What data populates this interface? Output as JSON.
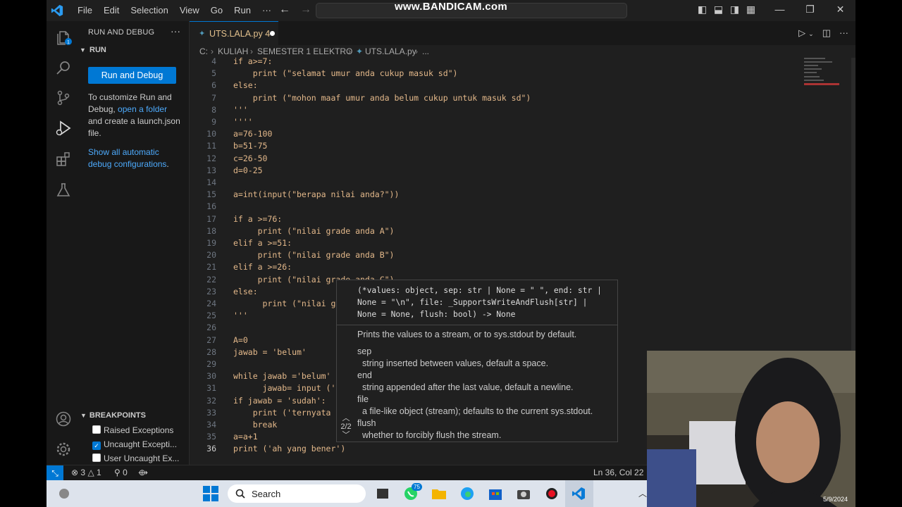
{
  "watermark": "www.BANDICAM.com",
  "menu": [
    "File",
    "Edit",
    "Selection",
    "View",
    "Go",
    "Run",
    "···"
  ],
  "sidebar": {
    "title": "RUN AND DEBUG",
    "section": "RUN",
    "run_button": "Run and Debug",
    "help_line1": "To customize Run and Debug,",
    "help_link": "open a folder",
    "help_line2": "and create a launch.json file.",
    "show_link": "Show all automatic debug configurations",
    "show_end": ".",
    "breakpoints_title": "BREAKPOINTS",
    "breakpoints": [
      {
        "label": "Raised Exceptions",
        "checked": false
      },
      {
        "label": "Uncaught Excepti...",
        "checked": true
      },
      {
        "label": "User Uncaught Ex...",
        "checked": false
      }
    ]
  },
  "tab": {
    "label": "UTS.LALA.py",
    "badge": "4",
    "icon": "python-file-icon"
  },
  "breadcrumb": [
    "C:",
    "KULIAH",
    "SEMESTER 1 ELEKTRO",
    "UTS.LALA.py",
    "..."
  ],
  "code_lines": [
    {
      "n": "4",
      "t": "if a>=7:"
    },
    {
      "n": "5",
      "t": "    print (\"selamat umur anda cukup masuk sd\")"
    },
    {
      "n": "6",
      "t": "else:"
    },
    {
      "n": "7",
      "t": "    print (\"mohon maaf umur anda belum cukup untuk masuk sd\")"
    },
    {
      "n": "8",
      "t": "'''"
    },
    {
      "n": "9",
      "t": "''''"
    },
    {
      "n": "10",
      "t": "a=76-100"
    },
    {
      "n": "11",
      "t": "b=51-75"
    },
    {
      "n": "12",
      "t": "c=26-50"
    },
    {
      "n": "13",
      "t": "d=0-25"
    },
    {
      "n": "14",
      "t": ""
    },
    {
      "n": "15",
      "t": "a=int(input(\"berapa nilai anda?\"))"
    },
    {
      "n": "16",
      "t": ""
    },
    {
      "n": "17",
      "t": "if a >=76:"
    },
    {
      "n": "18",
      "t": "     print (\"nilai grade anda A\")"
    },
    {
      "n": "19",
      "t": "elif a >=51:"
    },
    {
      "n": "20",
      "t": "     print (\"nilai grade anda B\")"
    },
    {
      "n": "21",
      "t": "elif a >=26:"
    },
    {
      "n": "22",
      "t": "     print (\"nilai grade anda C\")"
    },
    {
      "n": "23",
      "t": "else:"
    },
    {
      "n": "24",
      "t": "      print (\"nilai g"
    },
    {
      "n": "25",
      "t": "'''"
    },
    {
      "n": "26",
      "t": ""
    },
    {
      "n": "27",
      "t": "A=0"
    },
    {
      "n": "28",
      "t": "jawab = 'belum'"
    },
    {
      "n": "29",
      "t": ""
    },
    {
      "n": "30",
      "t": "while jawab ='belum'"
    },
    {
      "n": "31",
      "t": "      jawab= input ('"
    },
    {
      "n": "32",
      "t": "if jawab = 'sudah':"
    },
    {
      "n": "33",
      "t": "    print ('ternyata"
    },
    {
      "n": "34",
      "t": "    break"
    },
    {
      "n": "35",
      "t": "a=a+1"
    },
    {
      "n": "36",
      "t": "print ('ah yang bener')"
    }
  ],
  "hover": {
    "sig1": "(*values: object, sep: str | None = \" \", end: str |",
    "sig2": "None = \"\\n\", file: _SupportsWriteAndFlush[str] |",
    "sig3": "None = None, flush: bool) -> None",
    "summary": "Prints the values to a stream, or to sys.stdout by default.",
    "params": [
      {
        "name": "sep",
        "desc": "string inserted between values, default a space."
      },
      {
        "name": "end",
        "desc": "string appended after the last value, default a newline."
      },
      {
        "name": "file",
        "desc": "a file-like object (stream); defaults to the current sys.stdout."
      },
      {
        "name": "flush",
        "desc": "whether to forcibly flush the stream."
      }
    ],
    "pager": "2/2"
  },
  "status": {
    "errors": "3",
    "warnings": "1",
    "ports": "0",
    "position": "Ln 36, Col 22"
  },
  "taskbar": {
    "search": "Search",
    "whatsapp_badge": "75",
    "date": "5/9/2024"
  },
  "colors": {
    "accent": "#0078d4",
    "string": "#e3b88a",
    "bg": "#1f1f1f"
  }
}
